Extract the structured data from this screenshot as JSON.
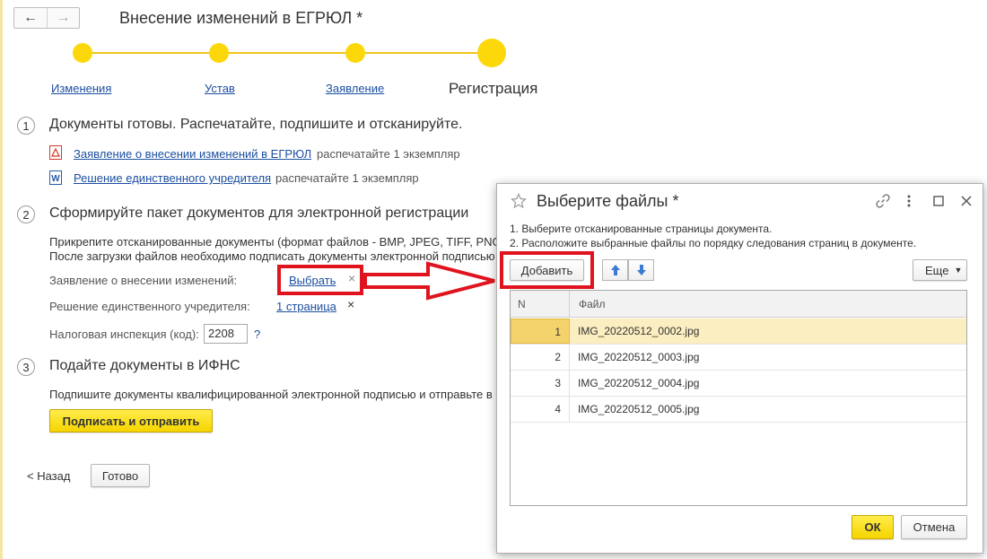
{
  "header": {
    "title": "Внесение изменений в ЕГРЮЛ *",
    "back_glyph": "←",
    "forward_glyph": "→"
  },
  "steps": [
    {
      "label": "Изменения"
    },
    {
      "label": "Устав"
    },
    {
      "label": "Заявление"
    },
    {
      "label": "Регистрация"
    }
  ],
  "section1": {
    "number": "1",
    "title": "Документы готовы. Распечатайте, подпишите и отсканируйте.",
    "docs": [
      {
        "icon": "pdf-icon",
        "link": "Заявление о внесении изменений в ЕГРЮЛ",
        "note": "распечатайте 1 экземпляр"
      },
      {
        "icon": "word-icon",
        "link": "Решение единственного учредителя",
        "note": "распечатайте 1 экземпляр"
      }
    ]
  },
  "section2": {
    "number": "2",
    "title": "Сформируйте пакет документов для электронной регистрации",
    "desc1": "Прикрепите отсканированные документы (формат файлов - BMP, JPEG, TIFF, PNG",
    "desc2": "После загрузки файлов необходимо подписать документы электронной подписью",
    "field1_label": "Заявление о внесении изменений:",
    "field1_link": "Выбрать",
    "field1_clear": "×",
    "field2_label": "Решение единственного учредителя:",
    "field2_link": "1 страница",
    "field2_clear": "×",
    "field3_label": "Налоговая инспекция (код):",
    "field3_value": "2208",
    "field3_help": "?"
  },
  "section3": {
    "number": "3",
    "title": "Подайте документы в ИФНС",
    "desc": "Подпишите документы квалифицированной электронной подписью и отправьте в н",
    "sign_button": "Подписать и отправить"
  },
  "footer": {
    "back": "< Назад",
    "done": "Готово"
  },
  "dialog": {
    "title": "Выберите файлы *",
    "instr1": "1. Выберите отсканированные страницы документа.",
    "instr2": "2. Расположите выбранные файлы по порядку следования страниц в документе.",
    "add_button": "Добавить",
    "more_button": "Еще",
    "col_n": "N",
    "col_file": "Файл",
    "rows": [
      {
        "n": "1",
        "file": "IMG_20220512_0002.jpg"
      },
      {
        "n": "2",
        "file": "IMG_20220512_0003.jpg"
      },
      {
        "n": "3",
        "file": "IMG_20220512_0004.jpg"
      },
      {
        "n": "4",
        "file": "IMG_20220512_0005.jpg"
      }
    ],
    "selected_row": 0,
    "ok": "ОК",
    "cancel": "Отмена"
  },
  "colors": {
    "accent_yellow": "#fcd80b",
    "link_blue": "#1c4fa0",
    "highlight_red": "#e0141e",
    "selected_row": "#fbeec0"
  }
}
